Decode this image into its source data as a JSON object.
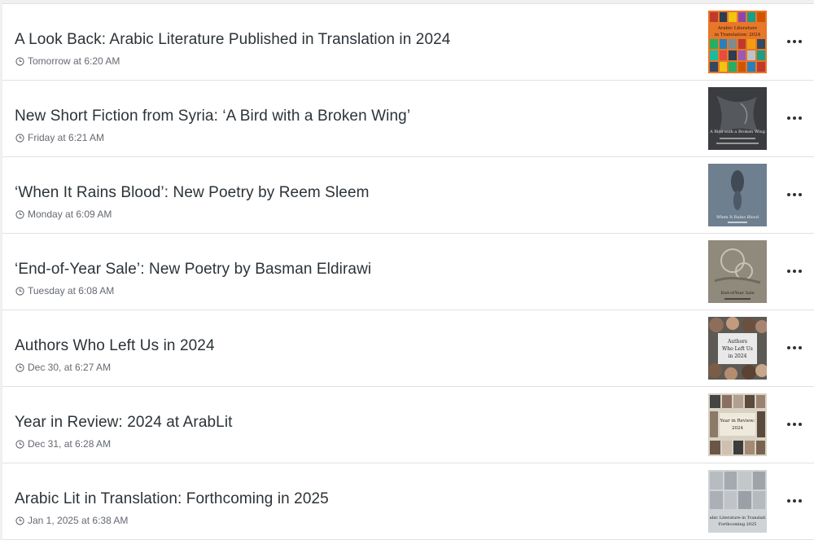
{
  "posts": [
    {
      "title": "A Look Back: Arabic Literature Published in Translation in 2024",
      "date": "Tomorrow at 6:20 AM",
      "thumb": {
        "lines": [
          "Arabic Literature",
          "in Translation: 2024"
        ]
      }
    },
    {
      "title": "New Short Fiction from Syria: ‘A Bird with a Broken Wing’",
      "date": "Friday at 6:21 AM",
      "thumb": {
        "lines": [
          "A Bird with a Broken Wing"
        ]
      }
    },
    {
      "title": "‘When It Rains Blood’: New Poetry by Reem Sleem",
      "date": "Monday at 6:09 AM",
      "thumb": {
        "lines": [
          "When It Rains Blood"
        ]
      }
    },
    {
      "title": "‘End-of-Year Sale’: New Poetry by Basman Eldirawi",
      "date": "Tuesday at 6:08 AM",
      "thumb": {
        "lines": [
          "End-of-Year Sale"
        ]
      }
    },
    {
      "title": "Authors Who Left Us in 2024",
      "date": "Dec 30, at 6:27 AM",
      "thumb": {
        "lines": [
          "Authors",
          "Who Left Us",
          "in 2024"
        ]
      }
    },
    {
      "title": "Year in Review: 2024 at ArabLit",
      "date": "Dec 31, at 6:28 AM",
      "thumb": {
        "lines": [
          "Year in Review:",
          "2024"
        ]
      }
    },
    {
      "title": "Arabic Lit in Translation: Forthcoming in 2025",
      "date": "Jan 1, 2025 at 6:38 AM",
      "thumb": {
        "lines": [
          "abic Literature in Translati",
          "Forthcoming 2025"
        ]
      }
    }
  ],
  "icons": {
    "date": "clock-icon",
    "menu": "more-options-icon"
  },
  "colors": {
    "title": "#2c3338",
    "meta": "#646970",
    "divider": "#e1e1e3"
  }
}
